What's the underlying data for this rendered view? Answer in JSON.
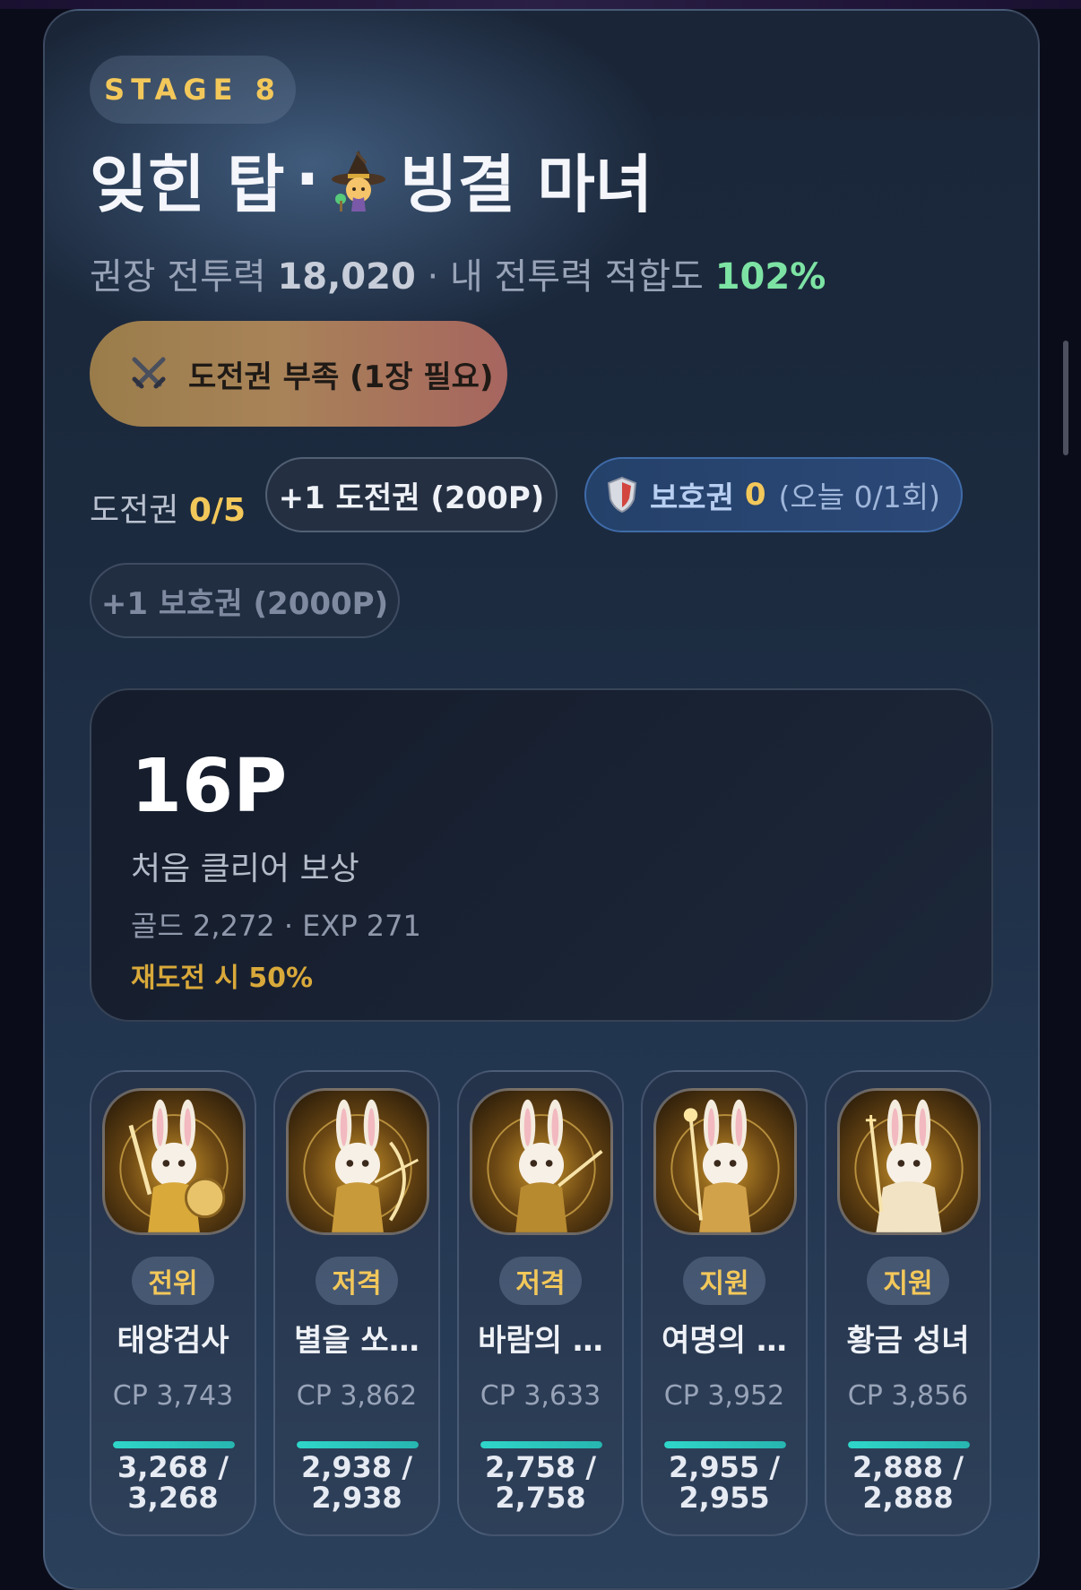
{
  "stage": {
    "badge": "STAGE 8"
  },
  "title": {
    "place": "잊힌 탑",
    "separator": "·",
    "icon": "witch-icon",
    "boss": "빙결 마녀"
  },
  "subtitle": {
    "rec_label": "권장 전투력",
    "rec_value": "18,020",
    "separator": "·",
    "fit_label": "내 전투력 적합도",
    "fit_value": "102%"
  },
  "challenge_button": {
    "icon": "crossed-swords-icon",
    "label": "도전권 부족 (1장 필요)"
  },
  "tickets": {
    "label": "도전권",
    "value": "0/5",
    "buy_label": "+1 도전권 (200P)"
  },
  "shield": {
    "icon": "shield-icon",
    "label": "보호권",
    "count": "0",
    "today": "(오늘 0/1회)",
    "buy_label": "+1 보호권 (2000P)"
  },
  "reward": {
    "points": "16P",
    "label": "처음 클리어 보상",
    "detail": "골드 2,272 · EXP 271",
    "retry": "재도전 시 50%"
  },
  "units": [
    {
      "role": "전위",
      "name": "태양검사",
      "cp": "CP 3,743",
      "hp": "3,268 / 3,268",
      "hp_fraction": 1.0,
      "portrait": "bunny-knight-portrait"
    },
    {
      "role": "저격",
      "name": "별을 쏘…",
      "cp": "CP 3,862",
      "hp": "2,938 / 2,938",
      "hp_fraction": 1.0,
      "portrait": "bunny-archer-portrait"
    },
    {
      "role": "저격",
      "name": "바람의 …",
      "cp": "CP 3,633",
      "hp": "2,758 / 2,758",
      "hp_fraction": 1.0,
      "portrait": "bunny-archer-portrait"
    },
    {
      "role": "지원",
      "name": "여명의 …",
      "cp": "CP 3,952",
      "hp": "2,955 / 2,955",
      "hp_fraction": 1.0,
      "portrait": "bunny-mage-portrait"
    },
    {
      "role": "지원",
      "name": "황금 성녀",
      "cp": "CP 3,856",
      "hp": "2,888 / 2,888",
      "hp_fraction": 1.0,
      "portrait": "bunny-saint-portrait"
    }
  ],
  "colors": {
    "gold": "#f3c85a",
    "green": "#7de3a4",
    "hp": "#2fd6c9",
    "shield_blue": "#2c4877"
  }
}
